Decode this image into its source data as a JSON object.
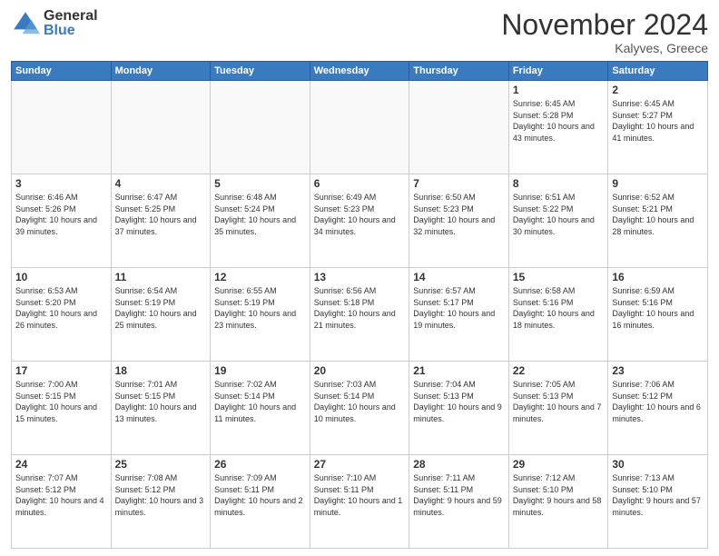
{
  "header": {
    "logo_general": "General",
    "logo_blue": "Blue",
    "month_title": "November 2024",
    "location": "Kalyves, Greece"
  },
  "weekdays": [
    "Sunday",
    "Monday",
    "Tuesday",
    "Wednesday",
    "Thursday",
    "Friday",
    "Saturday"
  ],
  "weeks": [
    [
      {
        "day": "",
        "info": ""
      },
      {
        "day": "",
        "info": ""
      },
      {
        "day": "",
        "info": ""
      },
      {
        "day": "",
        "info": ""
      },
      {
        "day": "",
        "info": ""
      },
      {
        "day": "1",
        "info": "Sunrise: 6:45 AM\nSunset: 5:28 PM\nDaylight: 10 hours\nand 43 minutes."
      },
      {
        "day": "2",
        "info": "Sunrise: 6:45 AM\nSunset: 5:27 PM\nDaylight: 10 hours\nand 41 minutes."
      }
    ],
    [
      {
        "day": "3",
        "info": "Sunrise: 6:46 AM\nSunset: 5:26 PM\nDaylight: 10 hours\nand 39 minutes."
      },
      {
        "day": "4",
        "info": "Sunrise: 6:47 AM\nSunset: 5:25 PM\nDaylight: 10 hours\nand 37 minutes."
      },
      {
        "day": "5",
        "info": "Sunrise: 6:48 AM\nSunset: 5:24 PM\nDaylight: 10 hours\nand 35 minutes."
      },
      {
        "day": "6",
        "info": "Sunrise: 6:49 AM\nSunset: 5:23 PM\nDaylight: 10 hours\nand 34 minutes."
      },
      {
        "day": "7",
        "info": "Sunrise: 6:50 AM\nSunset: 5:23 PM\nDaylight: 10 hours\nand 32 minutes."
      },
      {
        "day": "8",
        "info": "Sunrise: 6:51 AM\nSunset: 5:22 PM\nDaylight: 10 hours\nand 30 minutes."
      },
      {
        "day": "9",
        "info": "Sunrise: 6:52 AM\nSunset: 5:21 PM\nDaylight: 10 hours\nand 28 minutes."
      }
    ],
    [
      {
        "day": "10",
        "info": "Sunrise: 6:53 AM\nSunset: 5:20 PM\nDaylight: 10 hours\nand 26 minutes."
      },
      {
        "day": "11",
        "info": "Sunrise: 6:54 AM\nSunset: 5:19 PM\nDaylight: 10 hours\nand 25 minutes."
      },
      {
        "day": "12",
        "info": "Sunrise: 6:55 AM\nSunset: 5:19 PM\nDaylight: 10 hours\nand 23 minutes."
      },
      {
        "day": "13",
        "info": "Sunrise: 6:56 AM\nSunset: 5:18 PM\nDaylight: 10 hours\nand 21 minutes."
      },
      {
        "day": "14",
        "info": "Sunrise: 6:57 AM\nSunset: 5:17 PM\nDaylight: 10 hours\nand 19 minutes."
      },
      {
        "day": "15",
        "info": "Sunrise: 6:58 AM\nSunset: 5:16 PM\nDaylight: 10 hours\nand 18 minutes."
      },
      {
        "day": "16",
        "info": "Sunrise: 6:59 AM\nSunset: 5:16 PM\nDaylight: 10 hours\nand 16 minutes."
      }
    ],
    [
      {
        "day": "17",
        "info": "Sunrise: 7:00 AM\nSunset: 5:15 PM\nDaylight: 10 hours\nand 15 minutes."
      },
      {
        "day": "18",
        "info": "Sunrise: 7:01 AM\nSunset: 5:15 PM\nDaylight: 10 hours\nand 13 minutes."
      },
      {
        "day": "19",
        "info": "Sunrise: 7:02 AM\nSunset: 5:14 PM\nDaylight: 10 hours\nand 11 minutes."
      },
      {
        "day": "20",
        "info": "Sunrise: 7:03 AM\nSunset: 5:14 PM\nDaylight: 10 hours\nand 10 minutes."
      },
      {
        "day": "21",
        "info": "Sunrise: 7:04 AM\nSunset: 5:13 PM\nDaylight: 10 hours\nand 9 minutes."
      },
      {
        "day": "22",
        "info": "Sunrise: 7:05 AM\nSunset: 5:13 PM\nDaylight: 10 hours\nand 7 minutes."
      },
      {
        "day": "23",
        "info": "Sunrise: 7:06 AM\nSunset: 5:12 PM\nDaylight: 10 hours\nand 6 minutes."
      }
    ],
    [
      {
        "day": "24",
        "info": "Sunrise: 7:07 AM\nSunset: 5:12 PM\nDaylight: 10 hours\nand 4 minutes."
      },
      {
        "day": "25",
        "info": "Sunrise: 7:08 AM\nSunset: 5:12 PM\nDaylight: 10 hours\nand 3 minutes."
      },
      {
        "day": "26",
        "info": "Sunrise: 7:09 AM\nSunset: 5:11 PM\nDaylight: 10 hours\nand 2 minutes."
      },
      {
        "day": "27",
        "info": "Sunrise: 7:10 AM\nSunset: 5:11 PM\nDaylight: 10 hours\nand 1 minute."
      },
      {
        "day": "28",
        "info": "Sunrise: 7:11 AM\nSunset: 5:11 PM\nDaylight: 9 hours\nand 59 minutes."
      },
      {
        "day": "29",
        "info": "Sunrise: 7:12 AM\nSunset: 5:10 PM\nDaylight: 9 hours\nand 58 minutes."
      },
      {
        "day": "30",
        "info": "Sunrise: 7:13 AM\nSunset: 5:10 PM\nDaylight: 9 hours\nand 57 minutes."
      }
    ]
  ]
}
